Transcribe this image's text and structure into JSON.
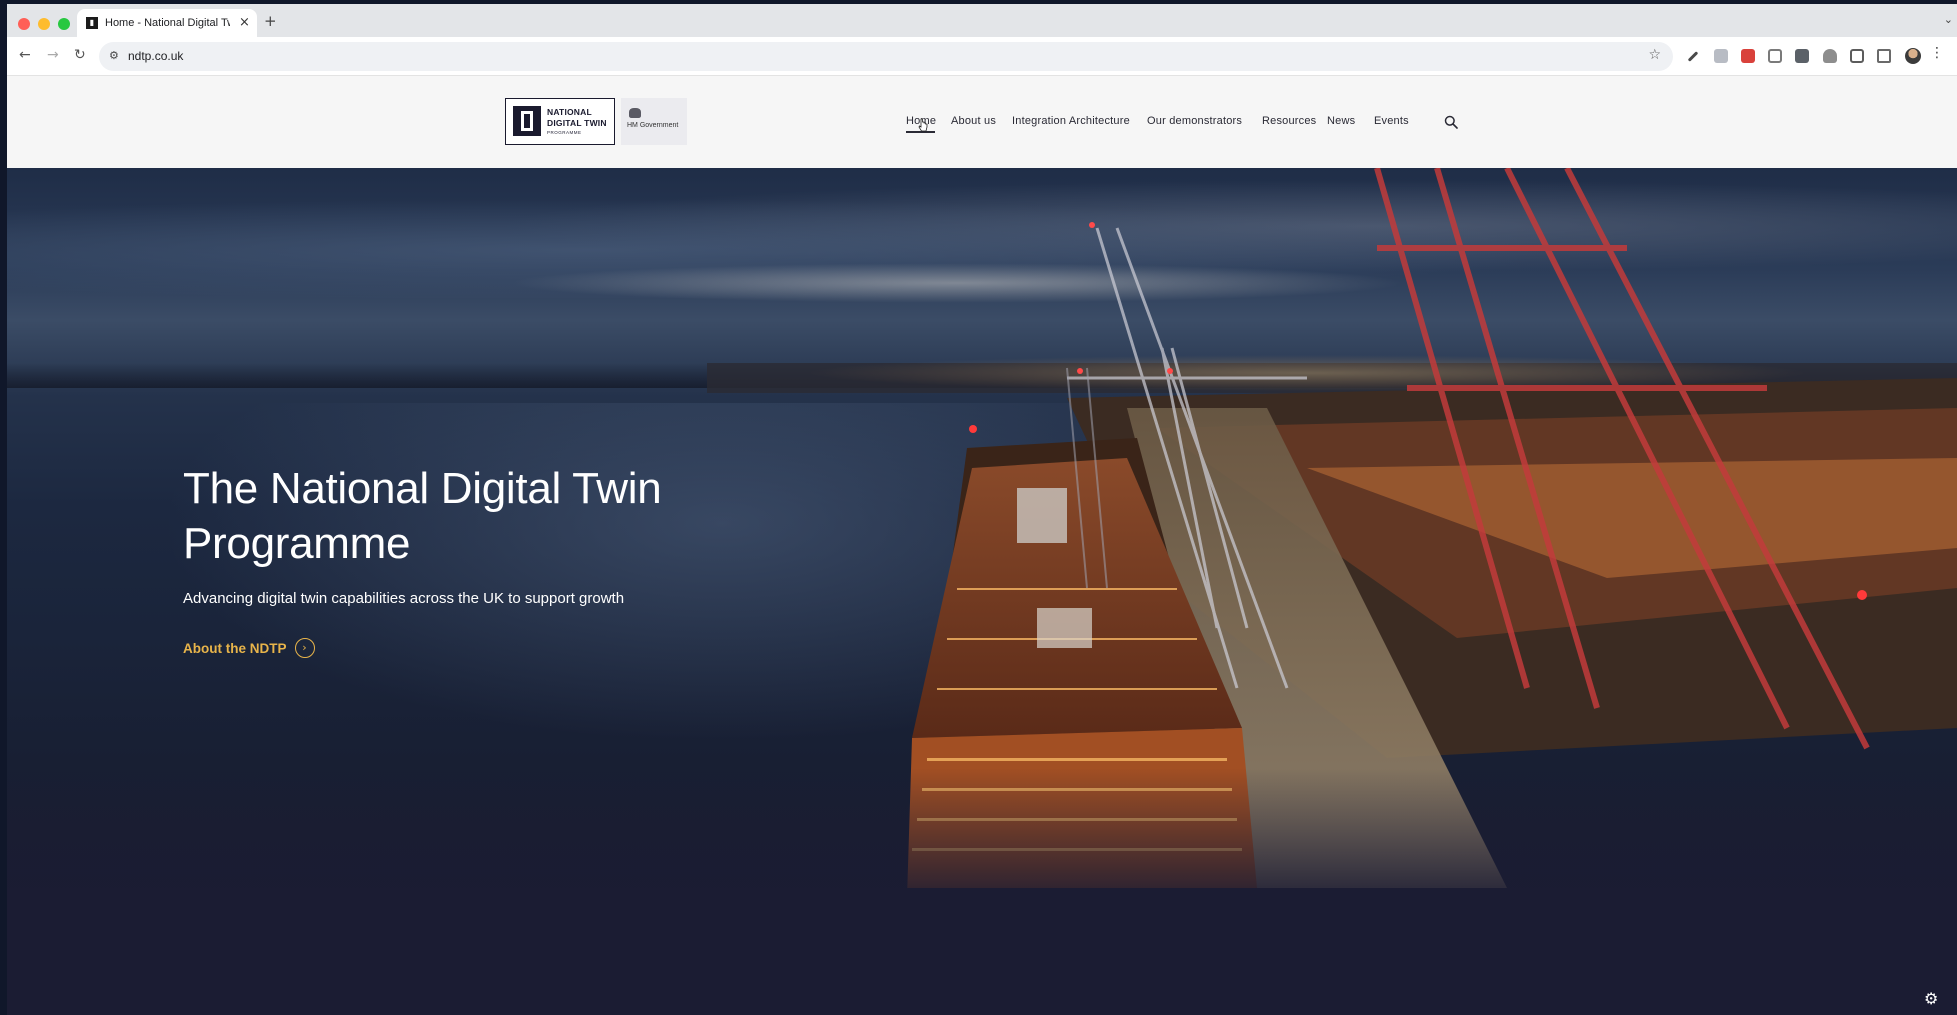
{
  "browser": {
    "tab_title": "Home - National Digital Twin",
    "tab_favicon": "▮",
    "tab_close": "×",
    "new_tab": "+",
    "tab_menu": "⌄",
    "url": "ndtp.co.uk",
    "back": "←",
    "forward": "→",
    "reload": "↻",
    "site_info_icon": "⚙",
    "bookmark": "☆",
    "menu": "⋮"
  },
  "header": {
    "logo": {
      "line1": "NATIONAL",
      "line2": "DIGITAL TWIN",
      "line3": "PROGRAMME"
    },
    "hmg_logo_text": "HM Government",
    "nav": [
      {
        "label": "Home",
        "active": true
      },
      {
        "label": "About us"
      },
      {
        "label": "Integration Architecture"
      },
      {
        "label": "Our demonstrators"
      },
      {
        "label": "Resources"
      },
      {
        "label": "News"
      },
      {
        "label": "Events"
      }
    ],
    "search_icon": "search-icon"
  },
  "hero": {
    "title": "The National Digital Twin Programme",
    "subtitle": "Advancing digital twin capabilities across the UK to support growth",
    "cta_label": "About the NDTP",
    "cta_icon": "›",
    "cta_color": "#e8b44a"
  },
  "settings_icon": "⚙",
  "colors": {
    "hero_background": "#1a243a",
    "header_background": "#f6f6f6",
    "text_dark": "#2a2a35"
  }
}
